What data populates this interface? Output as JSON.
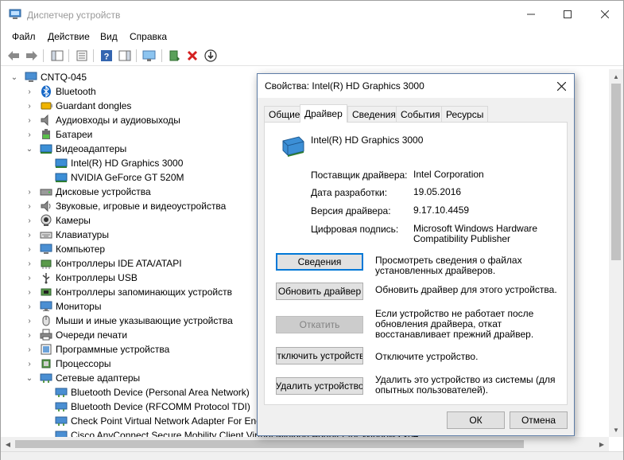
{
  "window": {
    "title": "Диспетчер устройств"
  },
  "menu": [
    "Файл",
    "Действие",
    "Вид",
    "Справка"
  ],
  "tree": {
    "root": "CNTQ-045",
    "categories": [
      {
        "label": "Bluetooth",
        "icon": "bluetooth-icon",
        "expanded": false
      },
      {
        "label": "Guardant dongles",
        "icon": "usb-dongle-icon",
        "expanded": false
      },
      {
        "label": "Аудиовходы и аудиовыходы",
        "icon": "speaker-icon",
        "expanded": false
      },
      {
        "label": "Батареи",
        "icon": "battery-icon",
        "expanded": false
      },
      {
        "label": "Видеоадаптеры",
        "icon": "display-adapter-icon",
        "expanded": true,
        "children": [
          "Intel(R) HD Graphics 3000",
          "NVIDIA GeForce GT 520M"
        ]
      },
      {
        "label": "Дисковые устройства",
        "icon": "disk-icon",
        "expanded": false
      },
      {
        "label": "Звуковые, игровые и видеоустройства",
        "icon": "sound-icon",
        "expanded": false
      },
      {
        "label": "Камеры",
        "icon": "camera-icon",
        "expanded": false
      },
      {
        "label": "Клавиатуры",
        "icon": "keyboard-icon",
        "expanded": false
      },
      {
        "label": "Компьютер",
        "icon": "computer-icon",
        "expanded": false
      },
      {
        "label": "Контроллеры IDE ATA/ATAPI",
        "icon": "ide-controller-icon",
        "expanded": false
      },
      {
        "label": "Контроллеры USB",
        "icon": "usb-icon",
        "expanded": false
      },
      {
        "label": "Контроллеры запоминающих устройств",
        "icon": "storage-controller-icon",
        "expanded": false
      },
      {
        "label": "Мониторы",
        "icon": "monitor-icon",
        "expanded": false
      },
      {
        "label": "Мыши и иные указывающие устройства",
        "icon": "mouse-icon",
        "expanded": false
      },
      {
        "label": "Очереди печати",
        "icon": "printer-icon",
        "expanded": false
      },
      {
        "label": "Программные устройства",
        "icon": "software-device-icon",
        "expanded": false
      },
      {
        "label": "Процессоры",
        "icon": "processor-icon",
        "expanded": false
      },
      {
        "label": "Сетевые адаптеры",
        "icon": "network-adapter-icon",
        "expanded": true,
        "children": [
          "Bluetooth Device (Personal Area Network)",
          "Bluetooth Device (RFCOMM Protocol TDI)",
          "Check Point Virtual Network Adapter For End",
          "Cisco AnyConnect Secure Mobility Client Virtual Miniport Adapter for Windows x64"
        ]
      }
    ]
  },
  "dialog": {
    "title": "Свойства: Intel(R) HD Graphics 3000",
    "tabs": [
      "Общие",
      "Драйвер",
      "Сведения",
      "События",
      "Ресурсы"
    ],
    "active_tab": "Драйвер",
    "device_name": "Intel(R) HD Graphics 3000",
    "props": {
      "provider_label": "Поставщик драйвера:",
      "provider_value": "Intel Corporation",
      "date_label": "Дата разработки:",
      "date_value": "19.05.2016",
      "version_label": "Версия драйвера:",
      "version_value": "9.17.10.4459",
      "signer_label": "Цифровая подпись:",
      "signer_value_1": "Microsoft Windows Hardware",
      "signer_value_2": "Compatibility Publisher"
    },
    "actions": {
      "details_btn": "Сведения",
      "details_desc_1": "Просмотреть сведения о файлах",
      "details_desc_2": "установленных драйверов.",
      "update_btn": "Обновить драйвер",
      "update_desc": "Обновить драйвер для этого устройства.",
      "rollback_btn": "Откатить",
      "rollback_desc_1": "Если устройство не работает после",
      "rollback_desc_2": "обновления драйвера, откат",
      "rollback_desc_3": "восстанавливает прежний драйвер.",
      "disable_btn": "Отключить устройство",
      "disable_desc": "Отключите устройство.",
      "uninstall_btn": "Удалить устройство",
      "uninstall_desc_1": "Удалить это устройство из системы (для",
      "uninstall_desc_2": "опытных пользователей)."
    },
    "ok": "ОК",
    "cancel": "Отмена"
  }
}
